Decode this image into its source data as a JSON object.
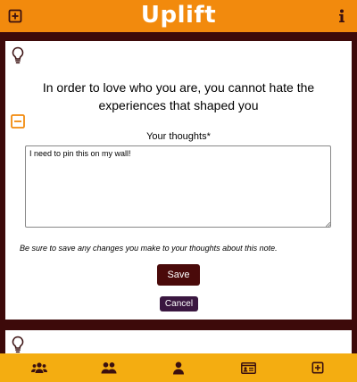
{
  "app": {
    "title": "Uplift"
  },
  "header": {
    "add_icon": "plus-square-icon",
    "info_icon": "info-icon"
  },
  "note": {
    "icon": "lightbulb-icon",
    "quote": "In order to love who you are, you cannot hate the experiences that shaped you",
    "collapse_icon": "minus-square-icon",
    "thoughts_label": "Your thoughts*",
    "thoughts_value": "I need to pin this on my wall!",
    "hint": "Be sure to save any changes you make to your thoughts about this note.",
    "save_label": "Save",
    "cancel_label": "Cancel"
  },
  "next_note": {
    "icon": "lightbulb-icon"
  },
  "bottom_nav": [
    {
      "icon": "users-group-icon"
    },
    {
      "icon": "user-pair-icon"
    },
    {
      "icon": "user-icon"
    },
    {
      "icon": "id-card-icon"
    },
    {
      "icon": "plus-square-icon"
    }
  ],
  "colors": {
    "header": "#f28a0d",
    "background": "#3d0a0a",
    "save_button": "#4a0a0a",
    "cancel_button": "#3a1740",
    "bottom_nav": "#f4ad11"
  }
}
